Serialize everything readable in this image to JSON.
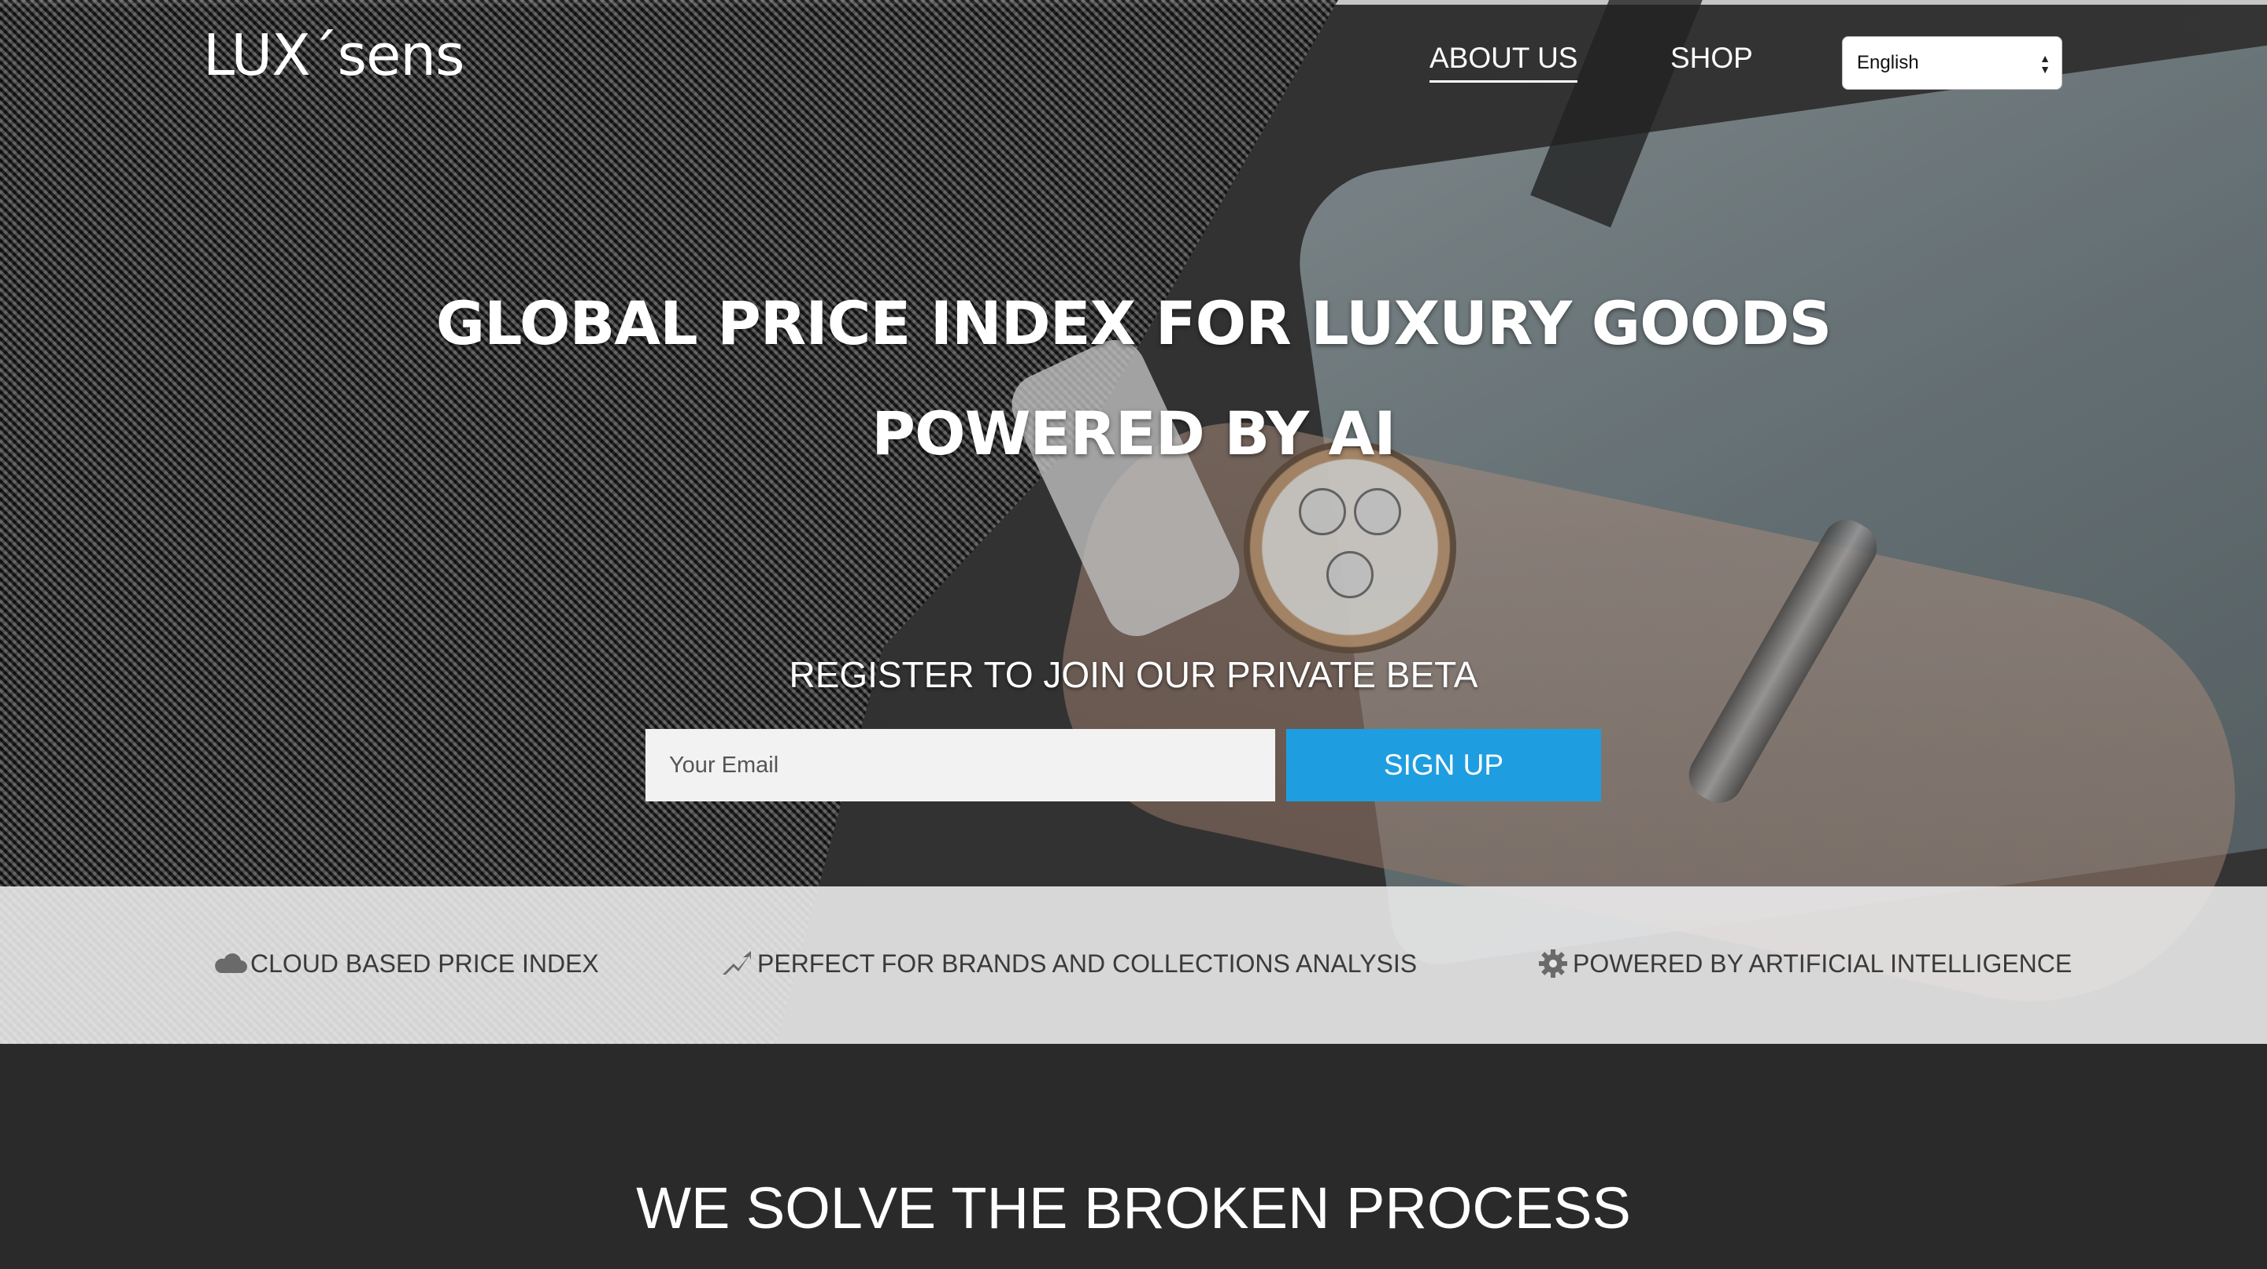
{
  "brand": {
    "logo_text": "LUX´sens"
  },
  "nav": {
    "about_label": "ABOUT US",
    "shop_label": "SHOP",
    "language_selected": "English"
  },
  "hero": {
    "headline_line1": "GLOBAL PRICE INDEX FOR LUXURY GOODS",
    "headline_line2": "POWERED BY AI",
    "register_label": "REGISTER TO JOIN OUR PRIVATE BETA",
    "email_placeholder": "Your Email",
    "signup_label": "SIGN UP"
  },
  "features": [
    {
      "icon": "cloud-icon",
      "label": "CLOUD BASED PRICE INDEX"
    },
    {
      "icon": "trend-arrow-icon",
      "label": "PERFECT FOR BRANDS AND COLLECTIONS ANALYSIS"
    },
    {
      "icon": "gear-icon",
      "label": "POWERED BY ARTIFICIAL INTELLIGENCE"
    }
  ],
  "section": {
    "title": "WE SOLVE THE BROKEN PROCESS"
  },
  "colors": {
    "accent": "#1e9ee0",
    "dark_bg": "#2a2a2a",
    "feature_bg": "#eeeeee"
  }
}
